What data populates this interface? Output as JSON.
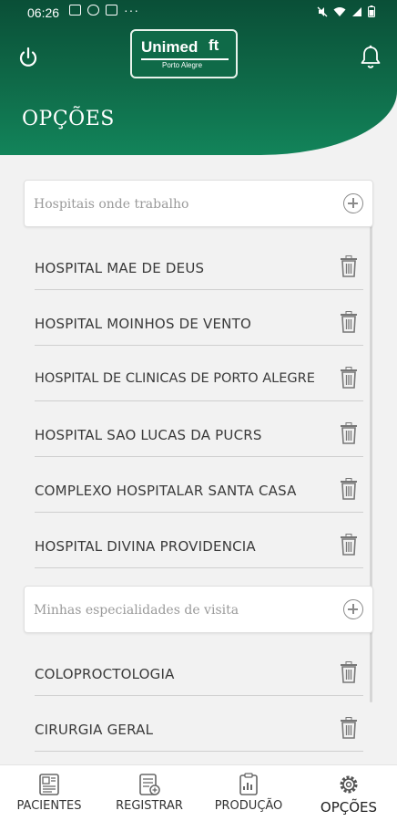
{
  "status_bar": {
    "time": "06:26"
  },
  "header": {
    "title": "OPÇÕES",
    "logo": {
      "brand": "Unimed",
      "region": "Porto Alegre"
    }
  },
  "hospitals": {
    "section_label": "Hospitais onde trabalho",
    "items": [
      {
        "label": "HOSPITAL MAE DE DEUS"
      },
      {
        "label": "HOSPITAL MOINHOS DE VENTO"
      },
      {
        "label": "HOSPITAL DE CLINICAS DE PORTO ALEGRE"
      },
      {
        "label": "HOSPITAL SAO LUCAS DA PUCRS"
      },
      {
        "label": "COMPLEXO HOSPITALAR SANTA CASA"
      },
      {
        "label": "HOSPITAL DIVINA PROVIDENCIA"
      }
    ]
  },
  "specialties": {
    "section_label": "Minhas especialidades de visita",
    "items": [
      {
        "label": "COLOPROCTOLOGIA"
      },
      {
        "label": "CIRURGIA GERAL"
      }
    ]
  },
  "bottom_nav": {
    "items": [
      {
        "label": "PACIENTES",
        "icon": "patients-icon"
      },
      {
        "label": "REGISTRAR",
        "icon": "register-icon"
      },
      {
        "label": "PRODUÇÃO",
        "icon": "production-icon"
      },
      {
        "label": "OPÇÕES",
        "icon": "gear-icon",
        "active": true
      }
    ]
  },
  "colors": {
    "brand_green": "#0f6b49",
    "text": "#3a3a3a",
    "muted": "#9a9a9a"
  }
}
